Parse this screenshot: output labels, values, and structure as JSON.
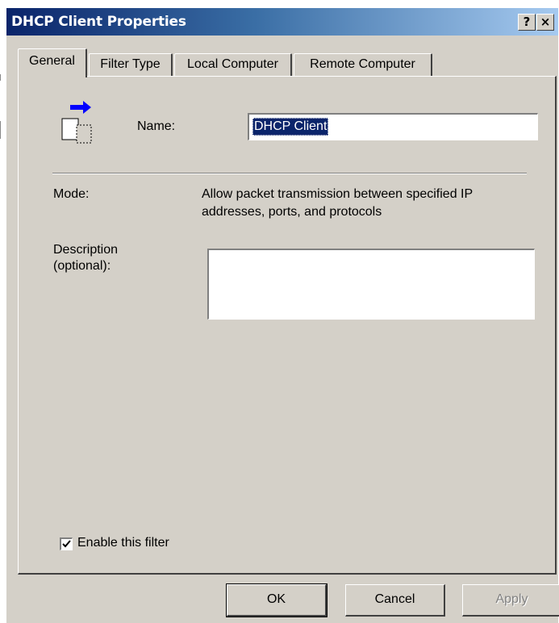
{
  "window": {
    "title": "DHCP Client Properties",
    "help_label": "?",
    "close_label": "×"
  },
  "tabs": [
    {
      "label": "General",
      "active": true
    },
    {
      "label": "Filter Type",
      "active": false
    },
    {
      "label": "Local Computer",
      "active": false
    },
    {
      "label": "Remote Computer",
      "active": false
    }
  ],
  "general": {
    "name_label": "Name:",
    "name_value": "DHCP Client",
    "mode_label": "Mode:",
    "mode_line1": "Allow packet transmission between specified IP",
    "mode_line2": "addresses, ports, and protocols",
    "description_label_line1": "Description",
    "description_label_line2": "(optional):",
    "description_value": "",
    "enable_label": "Enable this filter",
    "enable_checked": true
  },
  "buttons": {
    "ok": "OK",
    "cancel": "Cancel",
    "apply": "Apply"
  },
  "icons": {
    "filter": "filter-icon",
    "check": "checkmark-icon"
  }
}
